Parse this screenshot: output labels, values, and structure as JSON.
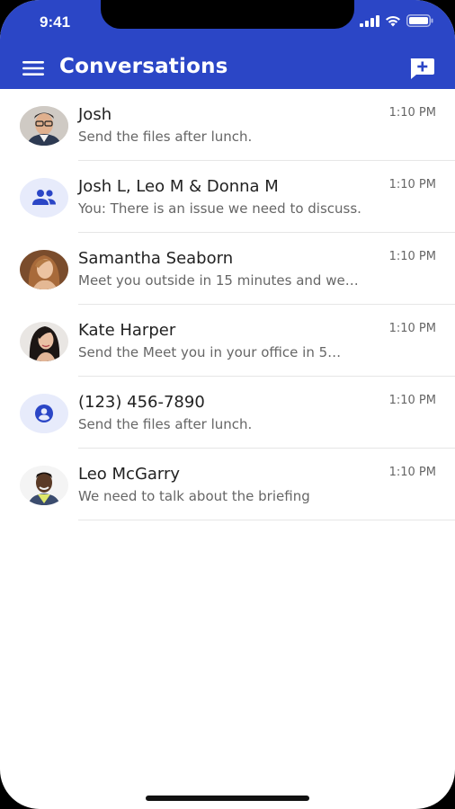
{
  "status_bar": {
    "time": "9:41"
  },
  "header": {
    "title": "Conversations"
  },
  "conversations": [
    {
      "name": "Josh",
      "preview": "Send the files after lunch.",
      "time": "1:10 PM",
      "avatar": "photo-josh"
    },
    {
      "name": "Josh L, Leo M & Donna M",
      "preview": "You: There is an issue we need to discuss.",
      "time": "1:10 PM",
      "avatar": "group-icon"
    },
    {
      "name": "Samantha Seaborn",
      "preview": "Meet you outside in 15 minutes and we…",
      "time": "1:10 PM",
      "avatar": "photo-samantha"
    },
    {
      "name": "Kate Harper",
      "preview": "Send the Meet you in your office in 5…",
      "time": "1:10 PM",
      "avatar": "photo-kate"
    },
    {
      "name": "(123) 456-7890",
      "preview": "Send the files after lunch.",
      "time": "1:10 PM",
      "avatar": "person-icon"
    },
    {
      "name": "Leo McGarry",
      "preview": "We need to talk about the briefing",
      "time": "1:10 PM",
      "avatar": "photo-leo"
    }
  ],
  "colors": {
    "header": "#2b46c6",
    "avatar_bg": "#e7ebfb",
    "icon": "#2b46c6"
  }
}
